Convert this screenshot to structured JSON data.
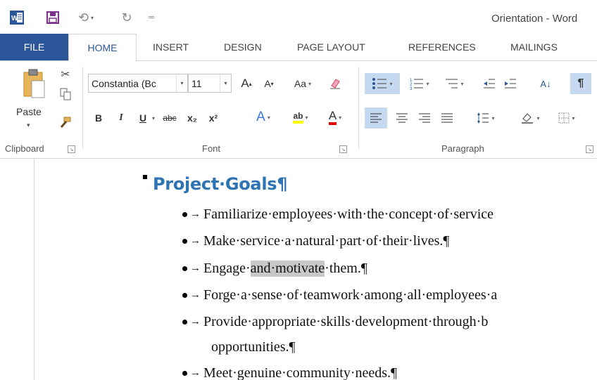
{
  "titlebar": {
    "title": "Orientation - Word",
    "undo_icon": "undo-icon",
    "redo_icon": "redo-icon"
  },
  "tabs": [
    "FILE",
    "HOME",
    "INSERT",
    "DESIGN",
    "PAGE LAYOUT",
    "REFERENCES",
    "MAILINGS"
  ],
  "ribbon": {
    "clipboard": {
      "label": "Clipboard",
      "paste": "Paste"
    },
    "font": {
      "label": "Font",
      "family": "Constantia (Bc",
      "size": "11",
      "change_case": "Aa",
      "bold": "B",
      "italic": "I",
      "underline": "U",
      "strike": "abc",
      "subscript": "x₂",
      "superscript": "x²",
      "effects": "A",
      "highlight": "ab",
      "font_color": "A",
      "grow": "A",
      "shrink": "A"
    },
    "paragraph": {
      "label": "Paragraph",
      "sort": "A↓",
      "pilcrow": "¶"
    }
  },
  "colors": {
    "file_tab": "#2b579a",
    "home_tab_text": "#2b579a",
    "heading": "#2e74b5",
    "highlight_yellow": "#ffff00",
    "font_red": "#e00000",
    "selected_button": "#c5d9f1",
    "text_selection": "#c8c8c8"
  },
  "document": {
    "heading": "Project·Goals¶",
    "bullets": [
      {
        "text": "Familiarize·employees·with·the·concept·of·service"
      },
      {
        "text": "Make·service·a·natural·part·of·their·lives.¶"
      },
      {
        "pre": "Engage·",
        "selected": "and·motivate",
        "post": "·them.¶"
      },
      {
        "text": "Forge·a·sense·of·teamwork·among·all·employees·a"
      },
      {
        "text": "Provide·appropriate·skills·development·through·b"
      },
      {
        "text": "opportunities.¶",
        "continuation": true
      },
      {
        "text": "Meet·genuine·community·needs.¶"
      }
    ],
    "arrow": "→"
  }
}
